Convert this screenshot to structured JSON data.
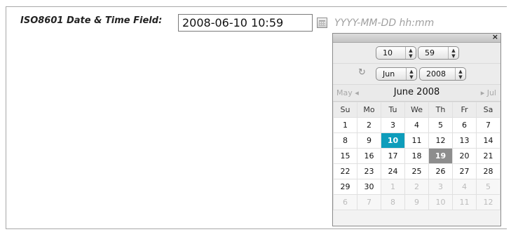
{
  "form": {
    "label": "ISO8601 Date & Time Field:",
    "value": "2008-06-10 10:59",
    "format_hint": "YYYY-MM-DD hh:mm",
    "trigger_icon": "calendar-icon"
  },
  "calendar": {
    "close_label": "×",
    "hour": "10",
    "minute": "59",
    "month": "Jun",
    "year": "2008",
    "refresh_icon": "↻",
    "prev_label": "May ◂",
    "next_label": "▸ Jul",
    "title": "June 2008",
    "weekdays": [
      "Su",
      "Mo",
      "Tu",
      "We",
      "Th",
      "Fr",
      "Sa"
    ],
    "selected_day": "10",
    "today_day": "19",
    "weeks": [
      [
        "1",
        "2",
        "3",
        "4",
        "5",
        "6",
        "7"
      ],
      [
        "8",
        "9",
        "10",
        "11",
        "12",
        "13",
        "14"
      ],
      [
        "15",
        "16",
        "17",
        "18",
        "19",
        "20",
        "21"
      ],
      [
        "22",
        "23",
        "24",
        "25",
        "26",
        "27",
        "28"
      ],
      [
        "29",
        "30",
        "1",
        "2",
        "3",
        "4",
        "5"
      ],
      [
        "6",
        "7",
        "8",
        "9",
        "10",
        "11",
        "12"
      ]
    ],
    "colors": {
      "selected": "#0e9dbb",
      "today": "#8d8d8d",
      "out_of_month": "#bcbcbc"
    }
  }
}
